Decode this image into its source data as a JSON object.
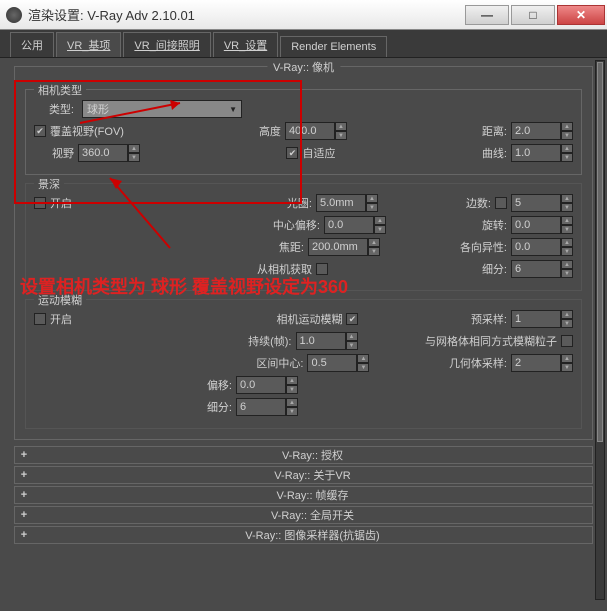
{
  "window": {
    "title": "渲染设置: V-Ray Adv 2.10.01"
  },
  "tabs": [
    "公用",
    "VR_基项",
    "VR_间接照明",
    "VR_设置",
    "Render Elements"
  ],
  "camera_group": {
    "title": "V-Ray:: 像机",
    "type_section": "相机类型",
    "type_label": "类型:",
    "type_value": "球形",
    "override_fov_label": "覆盖视野(FOV)",
    "height_label": "高度",
    "height_value": "400.0",
    "distance_label": "距离:",
    "distance_value": "2.0",
    "fov_label": "视野",
    "fov_value": "360.0",
    "adaptive_label": "自适应",
    "curve_label": "曲线:",
    "curve_value": "1.0"
  },
  "dof": {
    "title": "景深",
    "enable": "开启",
    "aperture_label": "光圈:",
    "aperture_value": "5.0mm",
    "sides_label": "边数:",
    "sides_value": "5",
    "center_bias_label": "中心偏移:",
    "center_bias_value": "0.0",
    "rotation_label": "旋转:",
    "rotation_value": "0.0",
    "focal_dist_label": "焦距:",
    "focal_dist_value": "200.0mm",
    "anisotropy_label": "各向异性:",
    "anisotropy_value": "0.0",
    "from_camera_label": "从相机获取",
    "subdivs_label": "细分:",
    "subdivs_value": "6"
  },
  "motion": {
    "title": "运动模糊",
    "enable": "开启",
    "camera_blur_label": "相机运动模糊",
    "presamples_label": "预采样:",
    "presamples_value": "1",
    "duration_label": "持续(帧):",
    "duration_value": "1.0",
    "mesh_label": "与网格体相同方式模糊粒子",
    "interval_label": "区间中心:",
    "interval_value": "0.5",
    "geom_samples_label": "几何体采样:",
    "geom_samples_value": "2",
    "bias_label": "偏移:",
    "bias_value": "0.0",
    "subdivs_label": "细分:",
    "subdivs_value": "6"
  },
  "rollups": [
    "V-Ray:: 授权",
    "V-Ray:: 关于VR",
    "V-Ray:: 帧缓存",
    "V-Ray:: 全局开关",
    "V-Ray:: 图像采样器(抗锯齿)"
  ],
  "annotation": "设置相机类型为 球形 覆盖视野设定为360"
}
